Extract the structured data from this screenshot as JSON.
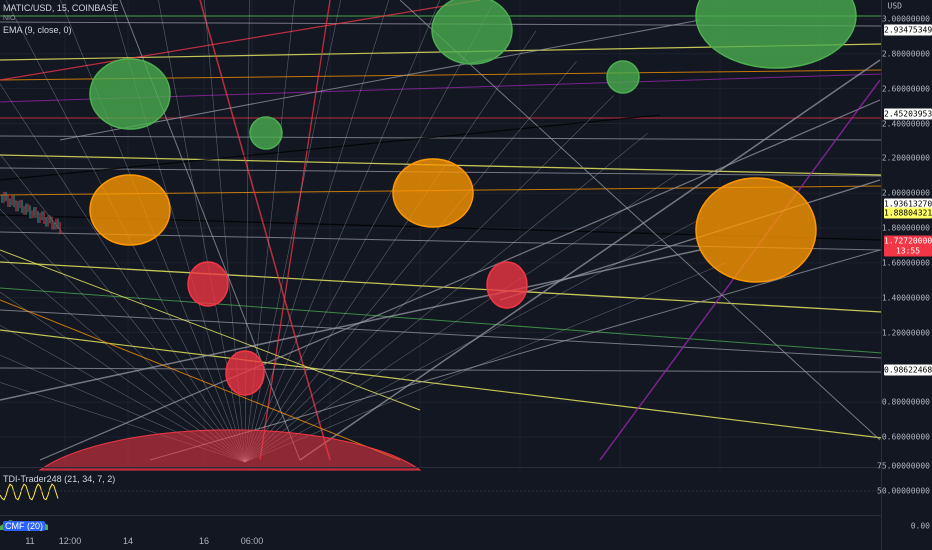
{
  "header": {
    "symbol": "MATIC/USD, 15, COINBASE",
    "sub": "NIO",
    "ema": "EMA (9, close, 0)",
    "currency": "USD"
  },
  "indicators": {
    "tdi": "TDI-Trader248 (21, 34, 7, 2)",
    "cmf": "CMF (20)"
  },
  "price_axis": {
    "ticks": [
      "3.00000000",
      "2.80000000",
      "2.60000000",
      "2.40000000",
      "2.20000000",
      "2.00000000",
      "1.80000000",
      "1.60000000",
      "1.40000000",
      "1.20000000",
      "0.80000000",
      "0.60000000"
    ],
    "tick_values": [
      3.0,
      2.8,
      2.6,
      2.4,
      2.2,
      2.0,
      1.8,
      1.6,
      1.4,
      1.2,
      0.8,
      0.6
    ],
    "bottom_label": "75.00000000",
    "tdi_label": "50.00000000",
    "cmf_label": "0.00"
  },
  "price_tags": [
    {
      "value": "2.93475349",
      "price": 2.93475349,
      "bg": "#ffffff",
      "fg": "#000000"
    },
    {
      "value": "2.45203953",
      "price": 2.45203953,
      "bg": "#ffffff",
      "fg": "#000000"
    },
    {
      "value": "1.93613270",
      "price": 1.9361327,
      "bg": "#ffffff",
      "fg": "#000000"
    },
    {
      "value": "1.88804321",
      "price": 1.88804321,
      "bg": "#ffff66",
      "fg": "#000000"
    },
    {
      "value": "1.72720000",
      "price": 1.7272,
      "bg": "#f23645",
      "fg": "#ffffff"
    },
    {
      "value": "13:55",
      "price": 1.668,
      "bg": "#f23645",
      "fg": "#ffffff"
    },
    {
      "value": "0.98622468",
      "price": 0.98622468,
      "bg": "#ffffff",
      "fg": "#000000"
    }
  ],
  "time_axis": [
    "11",
    "12:00",
    "14",
    "16",
    "06:00"
  ],
  "colors": {
    "background": "#131722",
    "green": "#4caf50",
    "orange": "#ff9800",
    "red": "#f23645",
    "yellow": "#ffff66",
    "gray": "#9598a1",
    "purple": "#9c27b0"
  },
  "chart_data": {
    "type": "line",
    "title": "MATIC/USD, 15, COINBASE",
    "xlabel": "",
    "ylabel": "USD",
    "x": [
      "11",
      "12:00",
      "14",
      "16",
      "06:00"
    ],
    "ylim": [
      0.55,
      3.05
    ],
    "series": [
      {
        "name": "EMA (9, close, 0)",
        "values": []
      }
    ],
    "annotations": {
      "circles": [
        {
          "color": "green",
          "count": 5
        },
        {
          "color": "orange",
          "count": 3
        },
        {
          "color": "red",
          "count": 4
        }
      ]
    },
    "grid": true
  }
}
